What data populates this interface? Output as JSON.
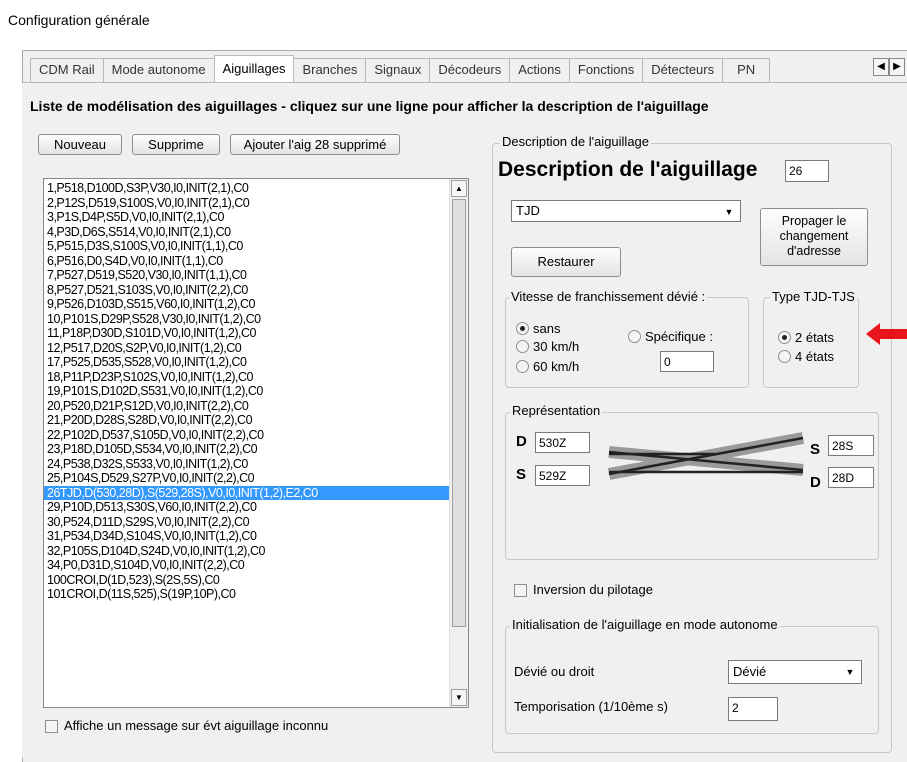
{
  "window": {
    "title": "Configuration générale"
  },
  "tabs": [
    "CDM Rail",
    "Mode autonome",
    "Aiguillages",
    "Branches",
    "Signaux",
    "Décodeurs",
    "Actions",
    "Fonctions",
    "Détecteurs",
    "PN"
  ],
  "heading": "Liste de modélisation des aiguillages - cliquez sur une ligne pour afficher la description de l'aiguillage",
  "buttons": {
    "nouveau": "Nouveau",
    "supprime": "Supprime",
    "ajouter": "Ajouter l'aig 28 supprimé",
    "restaurer": "Restaurer",
    "propager": "Propager le changement d'adresse"
  },
  "list": {
    "items": [
      "1,P518,D100D,S3P,V30,I0,INIT(2,1),C0",
      "2,P12S,D519,S100S,V0,I0,INIT(2,1),C0",
      "3,P1S,D4P,S5D,V0,I0,INIT(2,1),C0",
      "4,P3D,D6S,S514,V0,I0,INIT(2,1),C0",
      "5,P515,D3S,S100S,V0,I0,INIT(1,1),C0",
      "6,P516,D0,S4D,V0,I0,INIT(1,1),C0",
      "7,P527,D519,S520,V30,I0,INIT(1,1),C0",
      "8,P527,D521,S103S,V0,I0,INIT(2,2),C0",
      "9,P526,D103D,S515,V60,I0,INIT(1,2),C0",
      "10,P101S,D29P,S528,V30,I0,INIT(1,2),C0",
      "11,P18P,D30D,S101D,V0,I0,INIT(1,2),C0",
      "12,P517,D20S,S2P,V0,I0,INIT(1,2),C0",
      "17,P525,D535,S528,V0,I0,INIT(1,2),C0",
      "18,P11P,D23P,S102S,V0,I0,INIT(1,2),C0",
      "19,P101S,D102D,S531,V0,I0,INIT(1,2),C0",
      "20,P520,D21P,S12D,V0,I0,INIT(2,2),C0",
      "21,P20D,D28S,S28D,V0,I0,INIT(2,2),C0",
      "22,P102D,D537,S105D,V0,I0,INIT(2,2),C0",
      "23,P18D,D105D,S534,V0,I0,INIT(2,2),C0",
      "24,P538,D32S,S533,V0,I0,INIT(1,2),C0",
      "25,P104S,D529,S27P,V0,I0,INIT(2,2),C0",
      "26TJD,D(530,28D),S(529,28S),V0,I0,INIT(1,2),E2,C0",
      "29,P10D,D513,S30S,V60,I0,INIT(2,2),C0",
      "30,P524,D11D,S29S,V0,I0,INIT(2,2),C0",
      "31,P534,D34D,S104S,V0,I0,INIT(1,2),C0",
      "32,P105S,D104D,S24D,V0,I0,INIT(1,2),C0",
      "34,P0,D31D,S104D,V0,I0,INIT(2,2),C0",
      "100CROI,D(1D,523),S(2S,5S),C0",
      "101CROI,D(11S,525),S(19P,10P),C0"
    ],
    "selected_index": 21
  },
  "checkbox_unknown": "Affiche un message sur évt aiguillage inconnu",
  "description": {
    "group_label": "Description de l'aiguillage",
    "title": "Description de l'aiguillage",
    "number": "26",
    "type": "TJD",
    "vitesse": {
      "label": "Vitesse de franchissement dévié :",
      "options": [
        "sans",
        "30 km/h",
        "60 km/h"
      ],
      "specific_label": "Spécifique :",
      "specific_value": "0",
      "selected": "sans"
    },
    "type_tjd": {
      "label": "Type TJD-TJS",
      "options": [
        "2 états",
        "4 états"
      ],
      "selected": "2 états"
    },
    "representation": {
      "label": "Représentation",
      "left": [
        {
          "letter": "D",
          "value": "530Z"
        },
        {
          "letter": "S",
          "value": "529Z"
        }
      ],
      "right": [
        {
          "letter": "S",
          "value": "28S"
        },
        {
          "letter": "D",
          "value": "28D"
        }
      ]
    },
    "inversion_label": "Inversion du pilotage",
    "init": {
      "label": "Initialisation de l'aiguillage en mode autonome",
      "devie_label": "Dévié ou droit",
      "devie_value": "Dévié",
      "tempo_label": "Temporisation  (1/10ème s)",
      "tempo_value": "2"
    }
  },
  "colors": {
    "selection": "#3399ff",
    "arrow": "#e8141c",
    "panel": "#f0f0f0"
  }
}
